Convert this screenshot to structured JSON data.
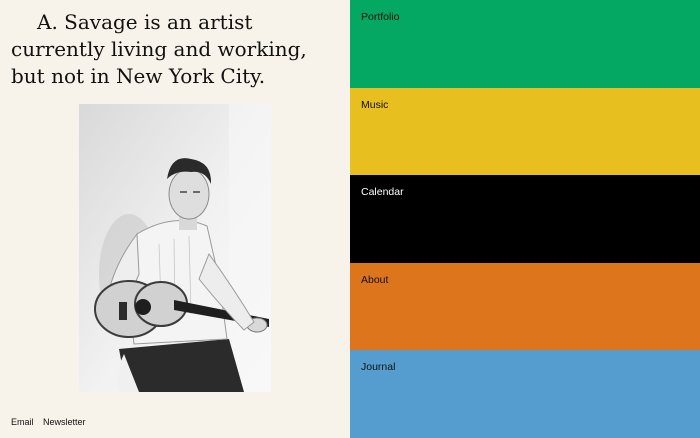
{
  "intro": {
    "text": "A. Savage is an artist currently living and working, but not in New York City."
  },
  "footer": {
    "links": [
      {
        "label": "Email"
      },
      {
        "label": "Newsletter"
      }
    ]
  },
  "nav": {
    "items": [
      {
        "label": "Portfolio",
        "color": "#05a862",
        "text_color": "#111111"
      },
      {
        "label": "Music",
        "color": "#e7bf1f",
        "text_color": "#111111"
      },
      {
        "label": "Calendar",
        "color": "#000000",
        "text_color": "#ffffff"
      },
      {
        "label": "About",
        "color": "#dc751b",
        "text_color": "#111111"
      },
      {
        "label": "Journal",
        "color": "#569dcf",
        "text_color": "#111111"
      }
    ]
  }
}
